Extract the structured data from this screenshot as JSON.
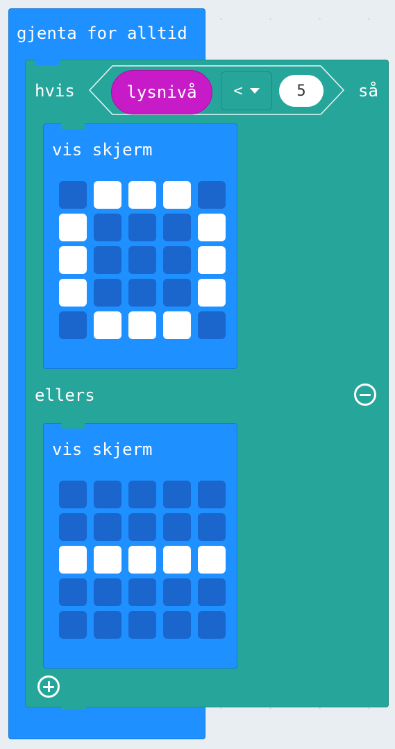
{
  "forever": {
    "label": "gjenta for alltid"
  },
  "if_block": {
    "if_label": "hvis",
    "then_label": "så",
    "else_label": "ellers",
    "condition": {
      "sensor": "lysnivå",
      "operator": "<",
      "value": "5"
    }
  },
  "then_show": {
    "label": "vis skjerm",
    "leds": [
      [
        0,
        1,
        1,
        1,
        0
      ],
      [
        1,
        0,
        0,
        0,
        1
      ],
      [
        1,
        0,
        0,
        0,
        1
      ],
      [
        1,
        0,
        0,
        0,
        1
      ],
      [
        0,
        1,
        1,
        1,
        0
      ]
    ]
  },
  "else_show": {
    "label": "vis skjerm",
    "leds": [
      [
        0,
        0,
        0,
        0,
        0
      ],
      [
        0,
        0,
        0,
        0,
        0
      ],
      [
        1,
        1,
        1,
        1,
        1
      ],
      [
        0,
        0,
        0,
        0,
        0
      ],
      [
        0,
        0,
        0,
        0,
        0
      ]
    ]
  },
  "icons": {
    "add_else": "plus-circle-icon",
    "remove_else": "minus-circle-icon",
    "dropdown": "caret-down-icon"
  },
  "colors": {
    "loops": "#1e90ff",
    "logic": "#26a69a",
    "input": "#c71bc8",
    "led_on": "#ffffff",
    "led_off": "#1a66cc"
  }
}
